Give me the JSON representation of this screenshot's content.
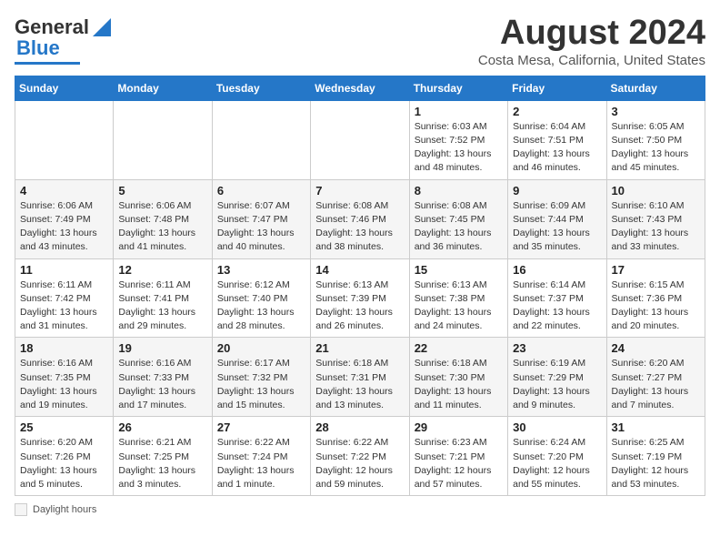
{
  "header": {
    "logo_general": "General",
    "logo_blue": "Blue",
    "title": "August 2024",
    "subtitle": "Costa Mesa, California, United States"
  },
  "calendar": {
    "days_of_week": [
      "Sunday",
      "Monday",
      "Tuesday",
      "Wednesday",
      "Thursday",
      "Friday",
      "Saturday"
    ],
    "weeks": [
      [
        {
          "day": "",
          "info": ""
        },
        {
          "day": "",
          "info": ""
        },
        {
          "day": "",
          "info": ""
        },
        {
          "day": "",
          "info": ""
        },
        {
          "day": "1",
          "info": "Sunrise: 6:03 AM\nSunset: 7:52 PM\nDaylight: 13 hours and 48 minutes."
        },
        {
          "day": "2",
          "info": "Sunrise: 6:04 AM\nSunset: 7:51 PM\nDaylight: 13 hours and 46 minutes."
        },
        {
          "day": "3",
          "info": "Sunrise: 6:05 AM\nSunset: 7:50 PM\nDaylight: 13 hours and 45 minutes."
        }
      ],
      [
        {
          "day": "4",
          "info": "Sunrise: 6:06 AM\nSunset: 7:49 PM\nDaylight: 13 hours and 43 minutes."
        },
        {
          "day": "5",
          "info": "Sunrise: 6:06 AM\nSunset: 7:48 PM\nDaylight: 13 hours and 41 minutes."
        },
        {
          "day": "6",
          "info": "Sunrise: 6:07 AM\nSunset: 7:47 PM\nDaylight: 13 hours and 40 minutes."
        },
        {
          "day": "7",
          "info": "Sunrise: 6:08 AM\nSunset: 7:46 PM\nDaylight: 13 hours and 38 minutes."
        },
        {
          "day": "8",
          "info": "Sunrise: 6:08 AM\nSunset: 7:45 PM\nDaylight: 13 hours and 36 minutes."
        },
        {
          "day": "9",
          "info": "Sunrise: 6:09 AM\nSunset: 7:44 PM\nDaylight: 13 hours and 35 minutes."
        },
        {
          "day": "10",
          "info": "Sunrise: 6:10 AM\nSunset: 7:43 PM\nDaylight: 13 hours and 33 minutes."
        }
      ],
      [
        {
          "day": "11",
          "info": "Sunrise: 6:11 AM\nSunset: 7:42 PM\nDaylight: 13 hours and 31 minutes."
        },
        {
          "day": "12",
          "info": "Sunrise: 6:11 AM\nSunset: 7:41 PM\nDaylight: 13 hours and 29 minutes."
        },
        {
          "day": "13",
          "info": "Sunrise: 6:12 AM\nSunset: 7:40 PM\nDaylight: 13 hours and 28 minutes."
        },
        {
          "day": "14",
          "info": "Sunrise: 6:13 AM\nSunset: 7:39 PM\nDaylight: 13 hours and 26 minutes."
        },
        {
          "day": "15",
          "info": "Sunrise: 6:13 AM\nSunset: 7:38 PM\nDaylight: 13 hours and 24 minutes."
        },
        {
          "day": "16",
          "info": "Sunrise: 6:14 AM\nSunset: 7:37 PM\nDaylight: 13 hours and 22 minutes."
        },
        {
          "day": "17",
          "info": "Sunrise: 6:15 AM\nSunset: 7:36 PM\nDaylight: 13 hours and 20 minutes."
        }
      ],
      [
        {
          "day": "18",
          "info": "Sunrise: 6:16 AM\nSunset: 7:35 PM\nDaylight: 13 hours and 19 minutes."
        },
        {
          "day": "19",
          "info": "Sunrise: 6:16 AM\nSunset: 7:33 PM\nDaylight: 13 hours and 17 minutes."
        },
        {
          "day": "20",
          "info": "Sunrise: 6:17 AM\nSunset: 7:32 PM\nDaylight: 13 hours and 15 minutes."
        },
        {
          "day": "21",
          "info": "Sunrise: 6:18 AM\nSunset: 7:31 PM\nDaylight: 13 hours and 13 minutes."
        },
        {
          "day": "22",
          "info": "Sunrise: 6:18 AM\nSunset: 7:30 PM\nDaylight: 13 hours and 11 minutes."
        },
        {
          "day": "23",
          "info": "Sunrise: 6:19 AM\nSunset: 7:29 PM\nDaylight: 13 hours and 9 minutes."
        },
        {
          "day": "24",
          "info": "Sunrise: 6:20 AM\nSunset: 7:27 PM\nDaylight: 13 hours and 7 minutes."
        }
      ],
      [
        {
          "day": "25",
          "info": "Sunrise: 6:20 AM\nSunset: 7:26 PM\nDaylight: 13 hours and 5 minutes."
        },
        {
          "day": "26",
          "info": "Sunrise: 6:21 AM\nSunset: 7:25 PM\nDaylight: 13 hours and 3 minutes."
        },
        {
          "day": "27",
          "info": "Sunrise: 6:22 AM\nSunset: 7:24 PM\nDaylight: 13 hours and 1 minute."
        },
        {
          "day": "28",
          "info": "Sunrise: 6:22 AM\nSunset: 7:22 PM\nDaylight: 12 hours and 59 minutes."
        },
        {
          "day": "29",
          "info": "Sunrise: 6:23 AM\nSunset: 7:21 PM\nDaylight: 12 hours and 57 minutes."
        },
        {
          "day": "30",
          "info": "Sunrise: 6:24 AM\nSunset: 7:20 PM\nDaylight: 12 hours and 55 minutes."
        },
        {
          "day": "31",
          "info": "Sunrise: 6:25 AM\nSunset: 7:19 PM\nDaylight: 12 hours and 53 minutes."
        }
      ]
    ]
  },
  "footer": {
    "daylight_label": "Daylight hours"
  }
}
